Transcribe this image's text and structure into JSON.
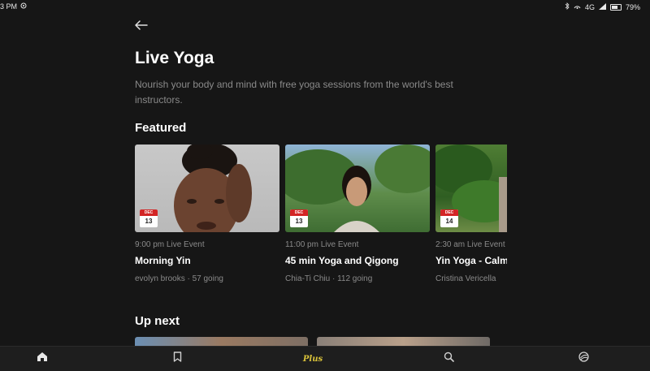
{
  "status_bar": {
    "time": "3 PM",
    "signal": "4G",
    "battery": "79%"
  },
  "header": {
    "back_icon": "arrow-left-icon",
    "title": "Live Yoga",
    "description": "Nourish your body and mind with free yoga sessions from the world's best instructors."
  },
  "featured": {
    "heading": "Featured",
    "events": [
      {
        "month": "DEC",
        "day": "13",
        "time": "9:00 pm Live Event",
        "title": "Morning Yin",
        "meta": "evolyn brooks · 57 going"
      },
      {
        "month": "DEC",
        "day": "13",
        "time": "11:00 pm Live Event",
        "title": "45 min Yoga and Qigong",
        "meta": "Chia-Ti Chiu · 112 going"
      },
      {
        "month": "DEC",
        "day": "14",
        "time": "2:30 am Live Event",
        "title": "Yin Yoga - Calm",
        "meta": "Cristina Vericella"
      }
    ]
  },
  "up_next": {
    "heading": "Up next"
  },
  "bottom_nav": {
    "items": [
      {
        "name": "home",
        "icon": "home-icon"
      },
      {
        "name": "saved",
        "icon": "bookmark-icon"
      },
      {
        "name": "plus",
        "label": "Plus"
      },
      {
        "name": "search",
        "icon": "search-icon"
      },
      {
        "name": "profile",
        "icon": "profile-icon"
      }
    ],
    "plus_color": "#d9c23a"
  },
  "colors": {
    "background": "#161616",
    "calendar_red": "#d32525",
    "muted_text": "#8a8a8a"
  }
}
